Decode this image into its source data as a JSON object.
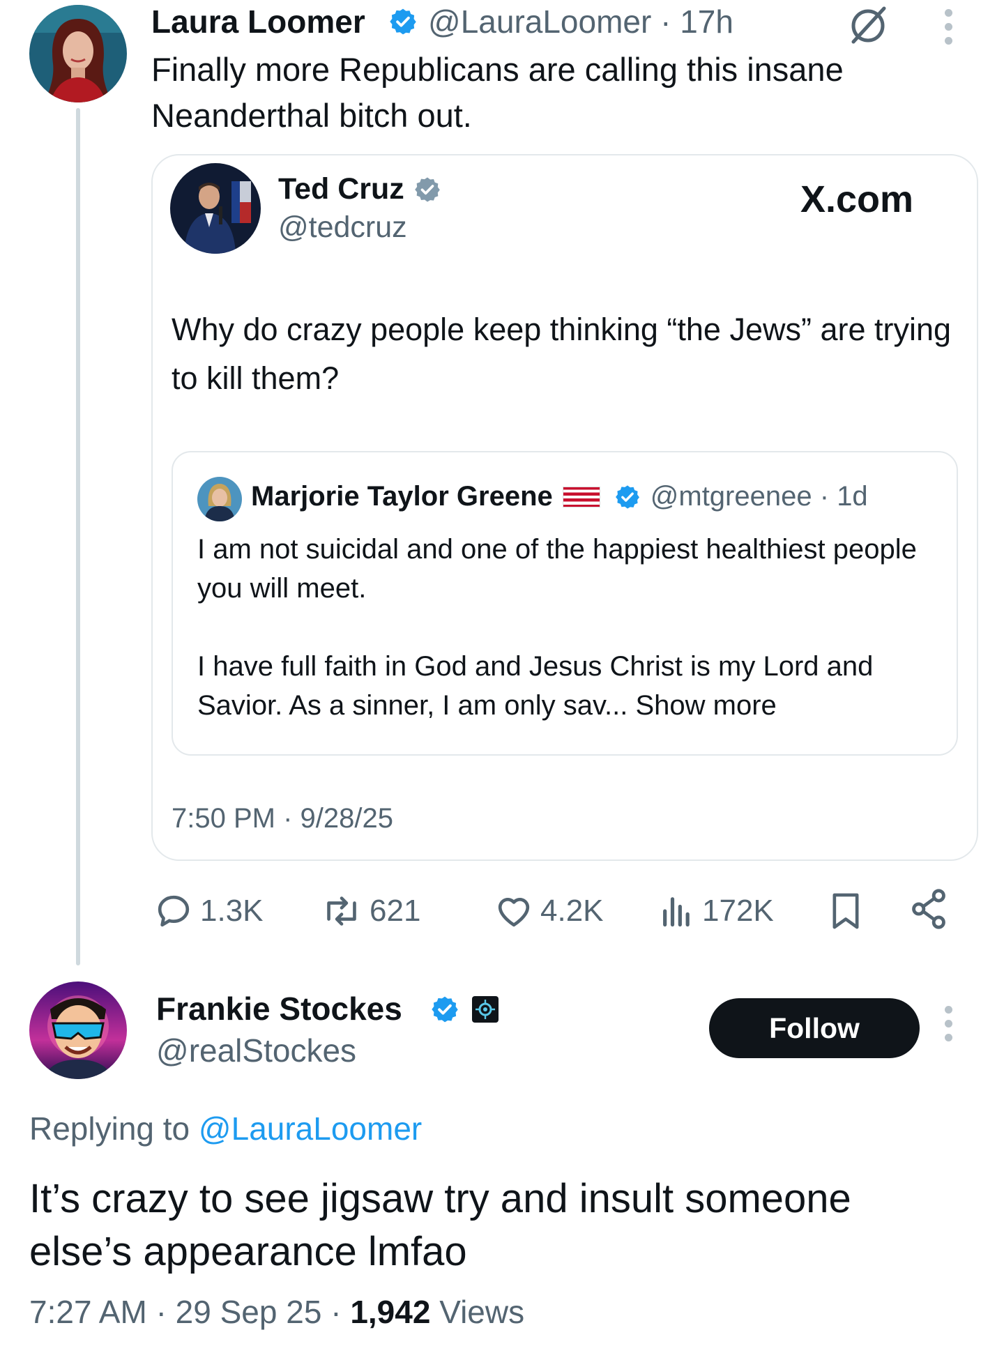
{
  "colors": {
    "verified_blue": "#1d9bf0",
    "link_blue": "#1d9bf0",
    "secondary": "#536471",
    "follow_bg": "#0f1419"
  },
  "parent_tweet": {
    "author_name": "Laura Loomer",
    "author_handle": "@LauraLoomer",
    "separator": "·",
    "time": "17h",
    "text": "Finally more Republicans are calling this insane Neanderthal bitch out."
  },
  "quoted_screenshot": {
    "author_name": "Ted Cruz",
    "author_handle": "@tedcruz",
    "brand": "X.com",
    "text": "Why do crazy people keep thinking “the Jews” are trying to kill them?",
    "timestamp": "7:50 PM · 9/28/25",
    "inner_quote": {
      "author_name": "Marjorie Taylor Greene",
      "flag": "🇺🇸",
      "author_handle": "@mtgreenee",
      "separator": "·",
      "time": "1d",
      "paragraph1": "I am not suicidal and one of the happiest healthiest people you will meet.",
      "paragraph2": "I have full faith in God and Jesus Christ is my Lord and Savior. As a sinner, I am only sav...",
      "show_more": "Show more"
    }
  },
  "actions": {
    "replies": "1.3K",
    "reposts": "621",
    "likes": "4.2K",
    "views": "172K"
  },
  "reply_tweet": {
    "author_name": "Frankie Stockes",
    "author_handle": "@realStockes",
    "follow_label": "Follow",
    "replying_prefix": "Replying to",
    "replying_handle": "@LauraLoomer",
    "text": "It’s crazy to see jigsaw try and insult someone else’s appearance lmfao",
    "time": "7:27 AM",
    "date": "29 Sep 25",
    "separator": "·",
    "views_count": "1,942",
    "views_label": "Views"
  }
}
